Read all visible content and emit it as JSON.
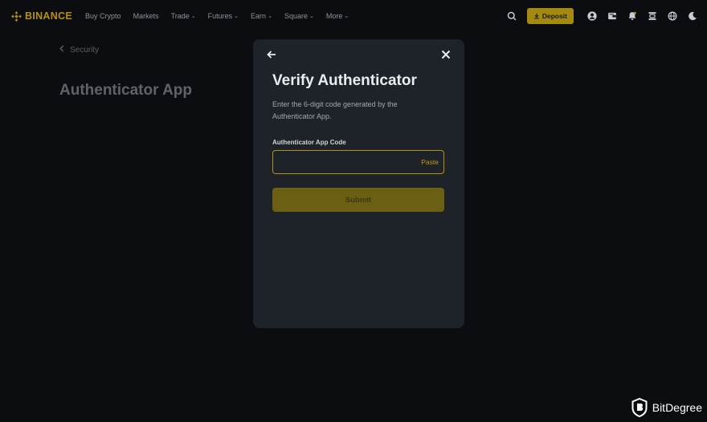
{
  "brand": {
    "name": "BINANCE",
    "color": "#b8900c"
  },
  "nav": {
    "items": [
      {
        "label": "Buy Crypto",
        "dropdown": false
      },
      {
        "label": "Markets",
        "dropdown": false
      },
      {
        "label": "Trade",
        "dropdown": true
      },
      {
        "label": "Futures",
        "dropdown": true
      },
      {
        "label": "Earn",
        "dropdown": true
      },
      {
        "label": "Square",
        "dropdown": true
      },
      {
        "label": "More",
        "dropdown": true
      }
    ]
  },
  "toolbar": {
    "search_icon": "search-icon",
    "deposit_label": "Deposit",
    "icons": [
      "profile-icon",
      "wallet-icon",
      "bell-icon",
      "download-icon",
      "globe-icon",
      "moon-icon"
    ]
  },
  "page": {
    "breadcrumb": "Security",
    "title": "Authenticator App"
  },
  "modal": {
    "title": "Verify Authenticator",
    "description": "Enter the 6-digit code generated by the Authenticator App.",
    "field_label": "Authenticator App Code",
    "input_value": "",
    "input_placeholder": "",
    "paste_label": "Paste",
    "submit_label": "Submit"
  },
  "watermark": {
    "text": "BitDegree"
  }
}
